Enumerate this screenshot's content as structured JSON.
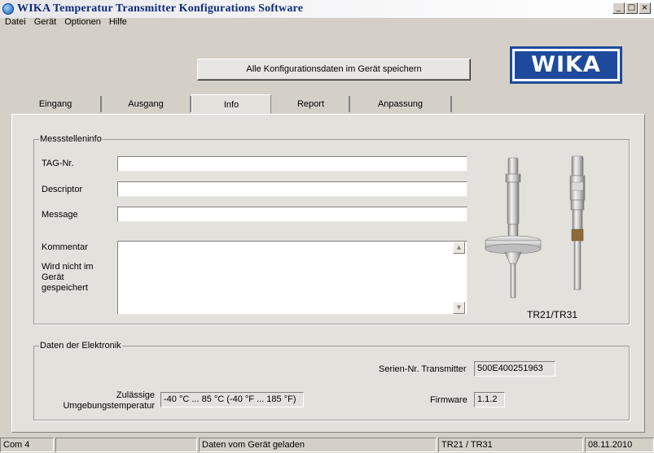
{
  "window": {
    "title": "WIKA Temperatur Transmitter Konfigurations Software"
  },
  "window_controls": {
    "minimize": "_",
    "maximize": "□",
    "close": "×"
  },
  "menu": {
    "items": [
      "Datei",
      "Gerät",
      "Optionen",
      "Hilfe"
    ]
  },
  "toolbar": {
    "save_label": "Alle Konfigurationsdaten im Gerät speichern"
  },
  "logo": {
    "text": "WIKA"
  },
  "tabs": [
    "Eingang",
    "Ausgang",
    "Info",
    "Report",
    "Anpassung"
  ],
  "active_tab": "Info",
  "measuring_point": {
    "title": "Messstelleninfo",
    "tag_label": "TAG-Nr.",
    "tag_value": "",
    "descriptor_label": "Descriptor",
    "descriptor_value": "",
    "message_label": "Message",
    "message_value": "",
    "comment_label": "Kommentar",
    "comment_note": "Wird nicht im Gerät gespeichert",
    "comment_value": ""
  },
  "product": {
    "caption": "TR21/TR31"
  },
  "electronics": {
    "title": "Daten der Elektronik",
    "serial_label": "Serien-Nr. Transmitter",
    "serial_value": "500E400251963",
    "temp_label": "Zulässige Umgebungstemperatur",
    "temp_value": "-40 °C ... 85 °C (-40 °F ... 185 °F)",
    "firmware_label": "Firmware",
    "firmware_value": "1.1.2"
  },
  "statusbar": {
    "port": "Com 4",
    "blank": "",
    "message": "Daten vom Gerät geladen",
    "device": "TR21 / TR31",
    "date": "08.11.2010"
  },
  "colors": {
    "title_text": "#0d2a7a",
    "logo_blue": "#1d4a9c",
    "panel": "#e3e1dc",
    "window": "#d4d0c8"
  },
  "icons": [
    "app-globe-icon",
    "scroll-up-arrow-icon",
    "scroll-down-arrow-icon"
  ]
}
